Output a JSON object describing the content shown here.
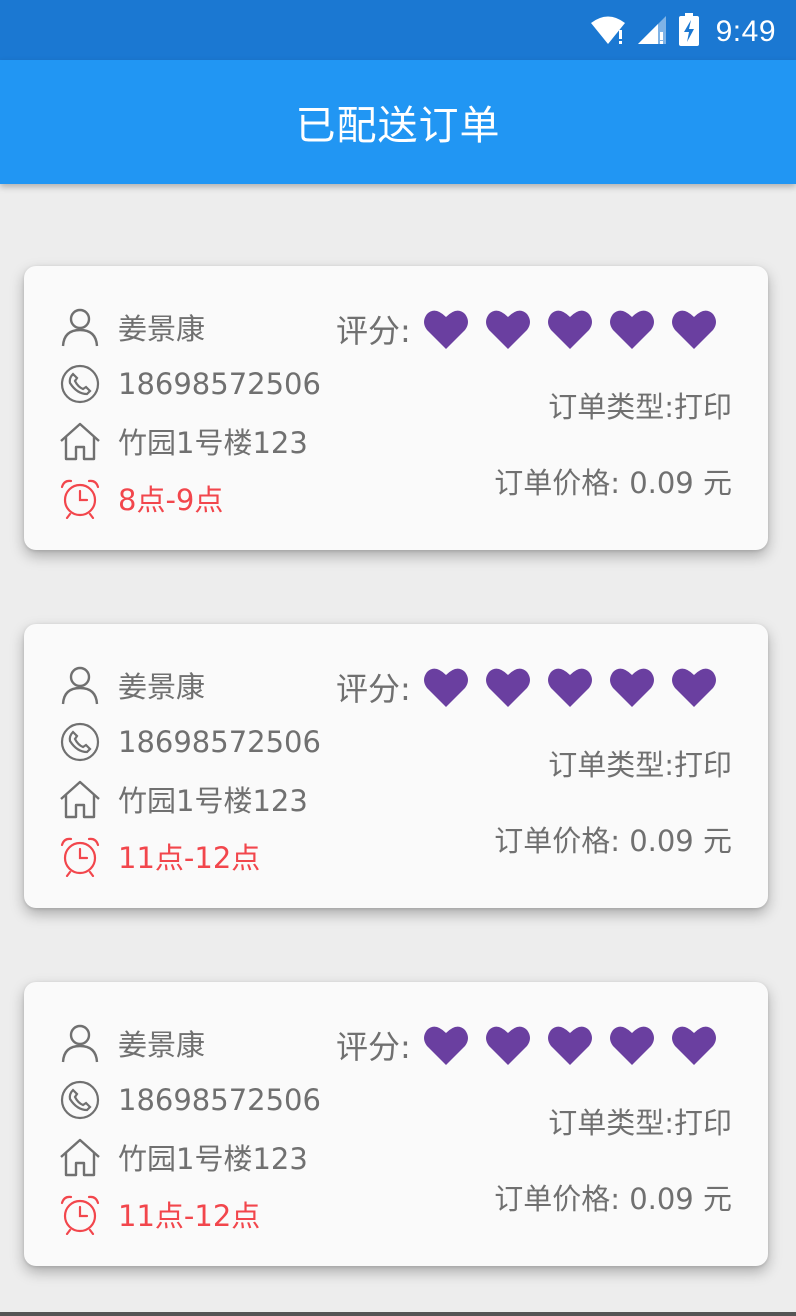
{
  "status_bar": {
    "time": "9:49",
    "icons": [
      "wifi-icon",
      "cell-signal-icon",
      "battery-charging-icon"
    ]
  },
  "app_bar": {
    "title": "已配送订单"
  },
  "orders": [
    {
      "name": "姜景康",
      "phone": "18698572506",
      "address": "竹园1号楼123",
      "time": "8点-9点",
      "rating_label": "评分:",
      "rating": 5,
      "order_type_label": "订单类型:",
      "order_type": "打印",
      "price_label": "订单价格:",
      "price": "0.09",
      "currency": "元"
    },
    {
      "name": "姜景康",
      "phone": "18698572506",
      "address": "竹园1号楼123",
      "time": "11点-12点",
      "rating_label": "评分:",
      "rating": 5,
      "order_type_label": "订单类型:",
      "order_type": "打印",
      "price_label": "订单价格:",
      "price": "0.09",
      "currency": "元"
    },
    {
      "name": "姜景康",
      "phone": "18698572506",
      "address": "竹园1号楼123",
      "time": "11点-12点",
      "rating_label": "评分:",
      "rating": 5,
      "order_type_label": "订单类型:",
      "order_type": "打印",
      "price_label": "订单价格:",
      "price": "0.09",
      "currency": "元"
    }
  ],
  "colors": {
    "status_bar": "#1b78d2",
    "app_bar": "#2196f3",
    "background": "#ededed",
    "card": "#fafafa",
    "text": "#707070",
    "time_text": "#f2464c",
    "heart": "#6a3fa0"
  }
}
